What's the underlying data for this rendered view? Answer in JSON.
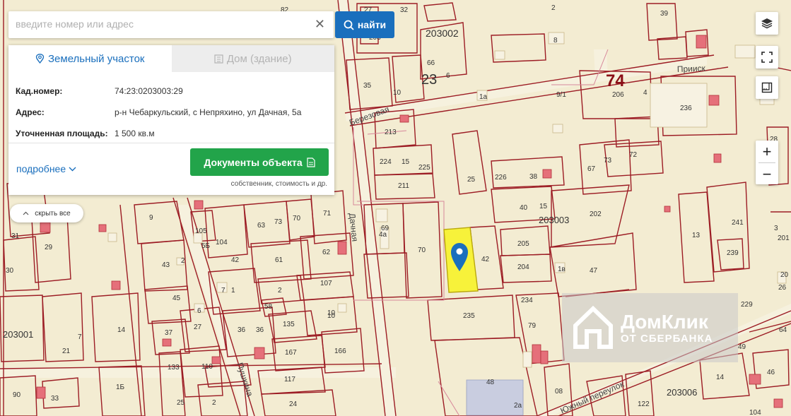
{
  "search": {
    "placeholder": "введите номер или адрес",
    "button_label": "найти"
  },
  "panel": {
    "tabs": [
      {
        "label": "Земельный участок",
        "active": true
      },
      {
        "label": "Дом (здание)",
        "active": false
      }
    ],
    "fields": [
      {
        "key": "Кад.номер:",
        "value": "74:23:0203003:29"
      },
      {
        "key": "Адрес:",
        "value": "р-н Чебаркульский, с Непряхино, ул Дачная, 5а"
      },
      {
        "key": "Уточненная площадь:",
        "value": "1 500 кв.м"
      }
    ],
    "more_label": "подробнее",
    "docs_button_label": "Документы объекта",
    "docs_caption": "собственник, стоимость и др."
  },
  "hide_all_label": "скрыть все",
  "watermark": {
    "line1": "ДомКлик",
    "line2": "ОТ СБЕРБАНКА"
  },
  "colors": {
    "map_background": "#f3ecd2",
    "plot_border": "#9c1c24",
    "selected_plot": "#f7f23a",
    "accent_blue": "#1a6fbd",
    "docs_green": "#22a44a"
  },
  "map": {
    "streets": [
      "Березовая",
      "Дачная",
      "Прииск",
      "Пушкина",
      "Южный переулок"
    ],
    "quarters": [
      "203002",
      "203003",
      "203006",
      "203001"
    ],
    "regions": [
      "74",
      "23"
    ],
    "plot_numbers": [
      "39",
      "32",
      "27",
      "203",
      "82",
      "2",
      "66",
      "6",
      "8",
      "35",
      "10",
      "1а",
      "9/1",
      "206",
      "4",
      "236",
      "213",
      "224",
      "15",
      "225",
      "211",
      "25",
      "226",
      "38",
      "67",
      "73",
      "72",
      "40",
      "15",
      "202",
      "9",
      "105",
      "63",
      "73",
      "70",
      "71",
      "4а",
      "69",
      "70",
      "42",
      "205",
      "204",
      "1в",
      "47",
      "31",
      "29",
      "30",
      "43",
      "2",
      "104",
      "5Б",
      "42",
      "61",
      "62",
      "107",
      "45",
      "6",
      "7",
      "1",
      "2",
      "58",
      "10",
      "235",
      "234",
      "79",
      "14",
      "37",
      "27",
      "36",
      "36",
      "135",
      "10",
      "13",
      "241",
      "239",
      "229",
      "21",
      "7",
      "133",
      "110",
      "167",
      "166",
      "48",
      "2а",
      "08",
      "14",
      "49",
      "90",
      "33",
      "1Б",
      "2",
      "117",
      "24",
      "25",
      "122",
      "104",
      "46",
      "64",
      "26",
      "20",
      "201",
      "3",
      "28",
      "10"
    ],
    "selected_plot_number": "42"
  }
}
